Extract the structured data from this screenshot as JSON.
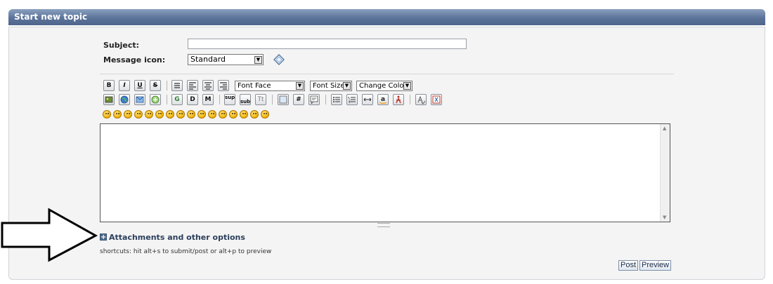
{
  "header": {
    "title": "Start new topic"
  },
  "form": {
    "subject_label": "Subject:",
    "subject_value": "",
    "icon_label": "Message icon:",
    "icon_value": "Standard"
  },
  "toolbar": {
    "bold": "B",
    "italic": "I",
    "underline": "U",
    "strike": "S",
    "font_face": "Font Face",
    "font_size": "Font Size",
    "change_color": "Change Color",
    "glow": "G",
    "shadow": "D",
    "marquee": "M",
    "sup": "sup",
    "sub": "sub",
    "teletype": "Tt",
    "hash": "#"
  },
  "footer": {
    "attachments_label": "Attachments and other options",
    "shortcuts": "shortcuts: hit alt+s to submit/post or alt+p to preview",
    "post_label": "Post",
    "preview_label": "Preview"
  }
}
